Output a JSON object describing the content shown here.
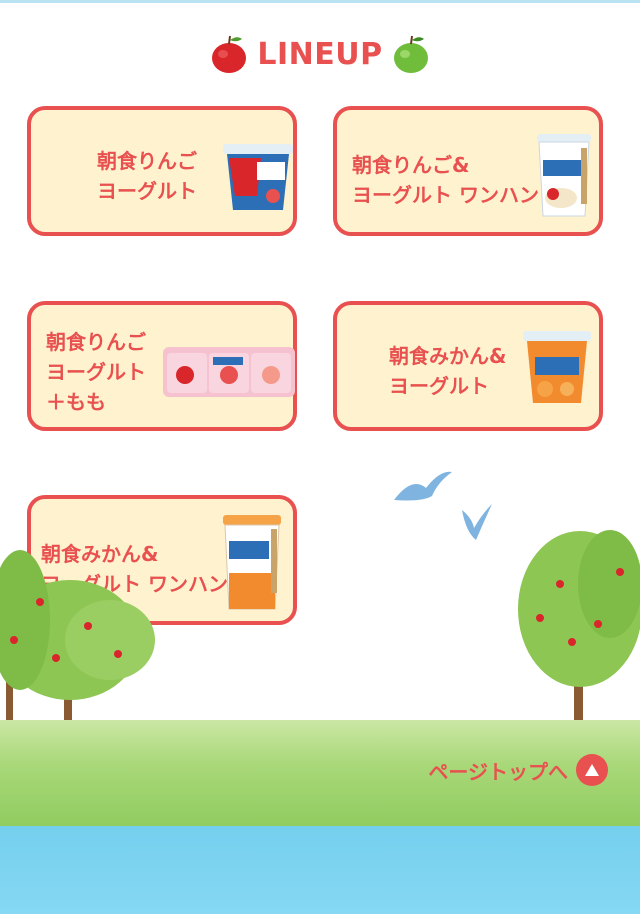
{
  "header": {
    "title": "LINEUP"
  },
  "products": [
    {
      "label": "朝食りんご\nヨーグルト"
    },
    {
      "label": "朝食りんご&\nヨーグルト ワンハンド"
    },
    {
      "label": "朝食りんご\nヨーグルト\n＋もも"
    },
    {
      "label": "朝食みかん&\nヨーグルト"
    },
    {
      "label": "朝食みかん&\nヨーグルト ワンハンド"
    }
  ],
  "footer": {
    "page_top_label": "ページトップへ"
  },
  "colors": {
    "accent": "#e8514f",
    "card_bg": "#fff2cf",
    "water": "#74cfee",
    "grass": "#a9d879"
  }
}
